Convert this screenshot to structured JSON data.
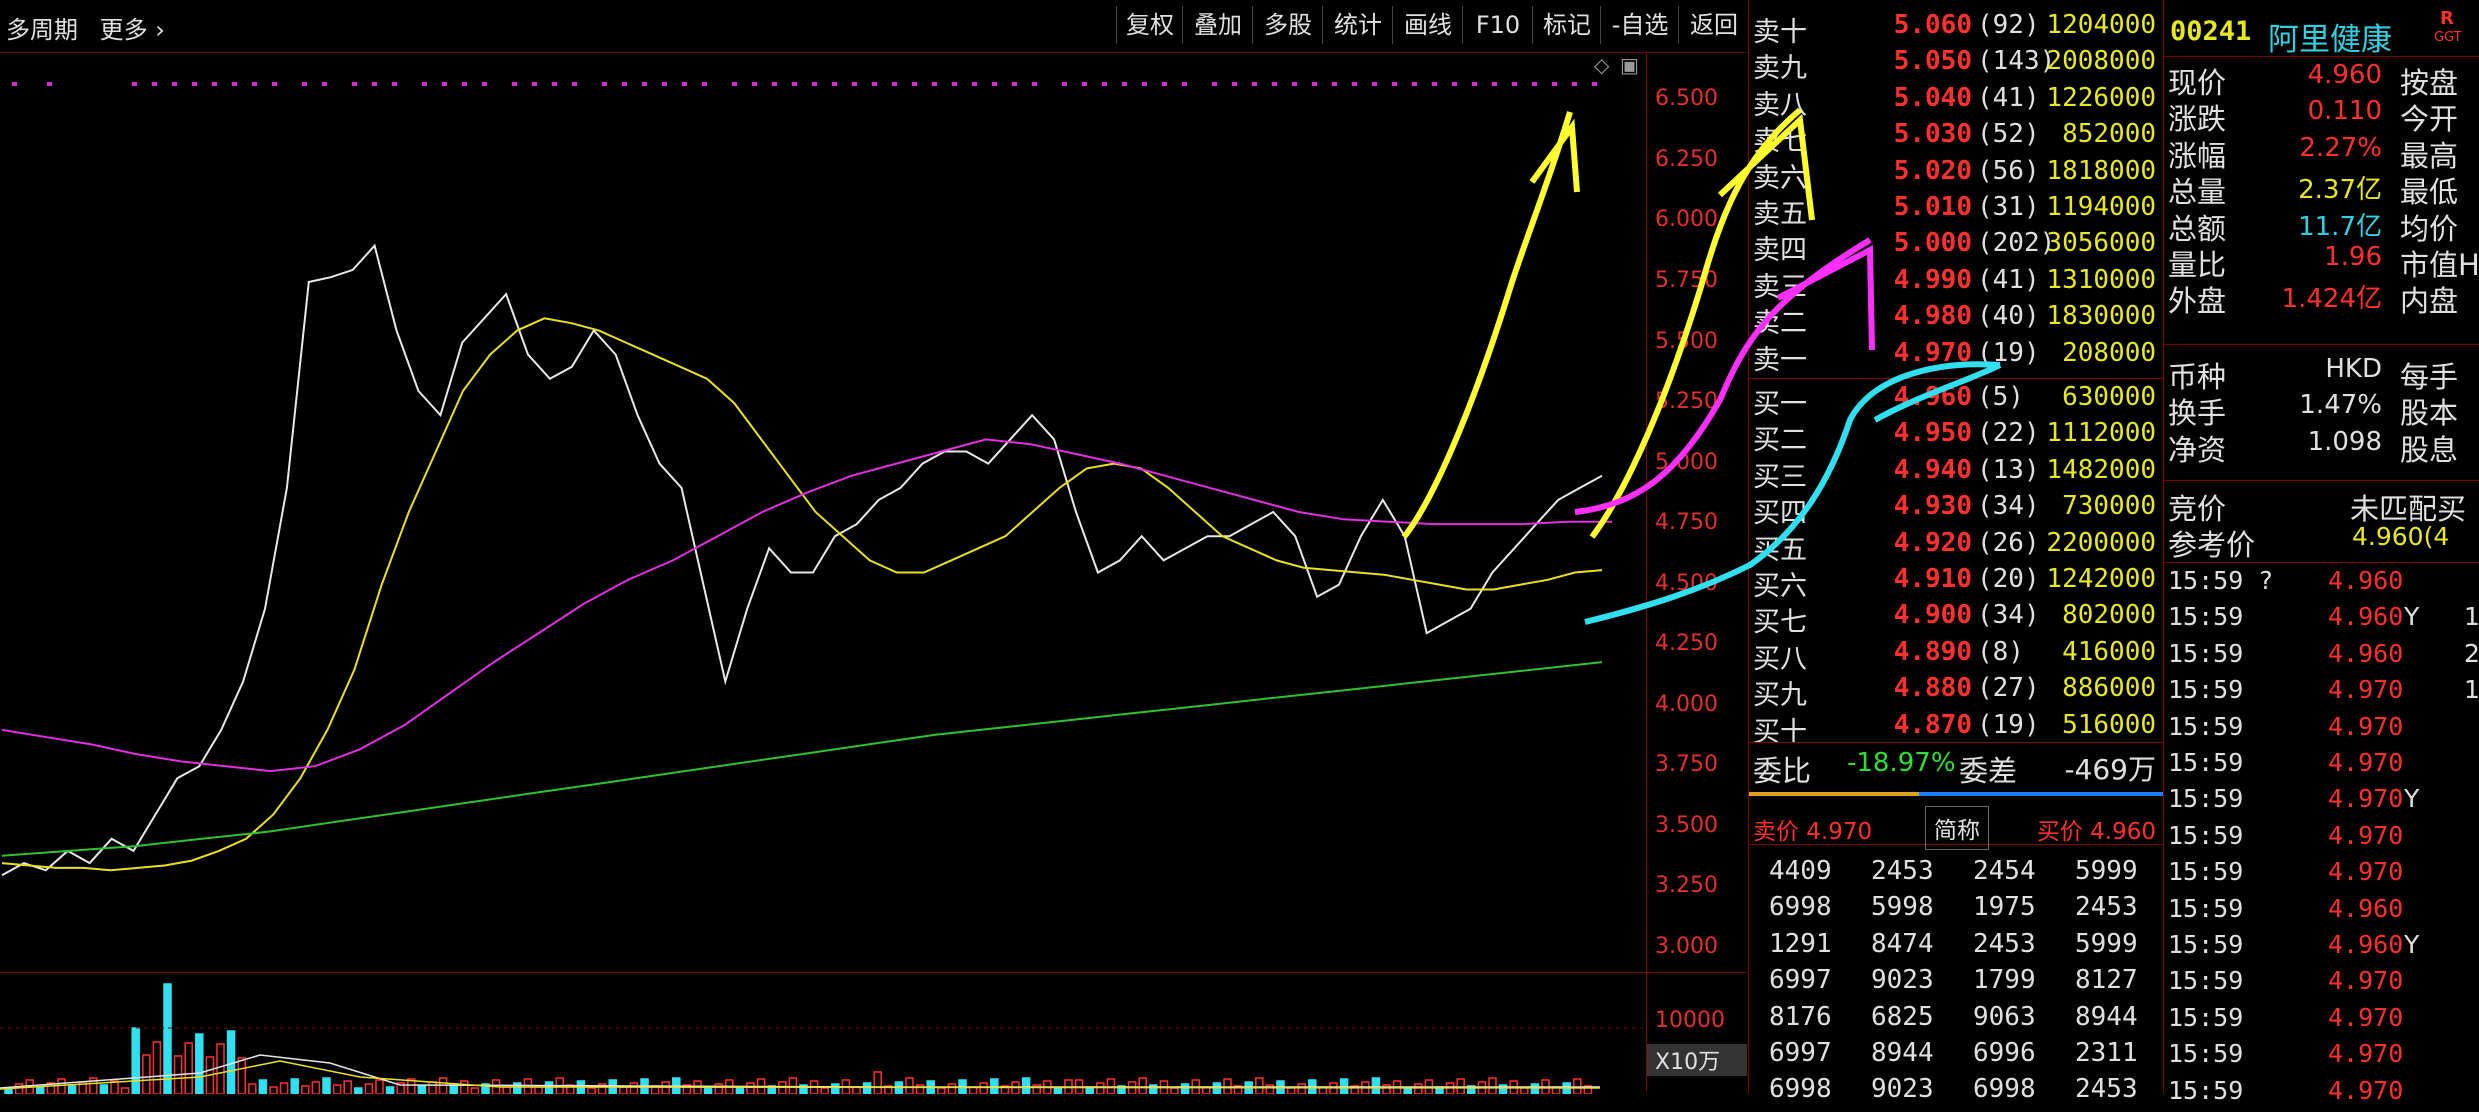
{
  "toolbar": {
    "period_label": "多周期",
    "more_label": "更多",
    "buttons": [
      "复权",
      "叠加",
      "多股",
      "统计",
      "画线",
      "F10",
      "标记",
      "-自选",
      "返回"
    ]
  },
  "price_axis": [
    "6.500",
    "6.250",
    "6.000",
    "5.750",
    "5.500",
    "5.250",
    "5.000",
    "4.750",
    "4.500",
    "4.250",
    "4.000",
    "3.750",
    "3.500",
    "3.250",
    "3.000"
  ],
  "volume_axis": {
    "top_label": "10000",
    "unit_label": "X10万"
  },
  "orderbook": {
    "asks": [
      {
        "label": "卖十",
        "price": "5.060",
        "count": "(92)",
        "volume": "1204000"
      },
      {
        "label": "卖九",
        "price": "5.050",
        "count": "(143)",
        "volume": "2008000"
      },
      {
        "label": "卖八",
        "price": "5.040",
        "count": "(41)",
        "volume": "1226000"
      },
      {
        "label": "卖七",
        "price": "5.030",
        "count": "(52)",
        "volume": "852000"
      },
      {
        "label": "卖六",
        "price": "5.020",
        "count": "(56)",
        "volume": "1818000"
      },
      {
        "label": "卖五",
        "price": "5.010",
        "count": "(31)",
        "volume": "1194000"
      },
      {
        "label": "卖四",
        "price": "5.000",
        "count": "(202)",
        "volume": "3056000"
      },
      {
        "label": "卖三",
        "price": "4.990",
        "count": "(41)",
        "volume": "1310000"
      },
      {
        "label": "卖二",
        "price": "4.980",
        "count": "(40)",
        "volume": "1830000"
      },
      {
        "label": "卖一",
        "price": "4.970",
        "count": "(19)",
        "volume": "208000"
      }
    ],
    "bids": [
      {
        "label": "买一",
        "price": "4.960",
        "count": "(5)",
        "volume": "630000"
      },
      {
        "label": "买二",
        "price": "4.950",
        "count": "(22)",
        "volume": "1112000"
      },
      {
        "label": "买三",
        "price": "4.940",
        "count": "(13)",
        "volume": "1482000"
      },
      {
        "label": "买四",
        "price": "4.930",
        "count": "(34)",
        "volume": "730000"
      },
      {
        "label": "买五",
        "price": "4.920",
        "count": "(26)",
        "volume": "2200000"
      },
      {
        "label": "买六",
        "price": "4.910",
        "count": "(20)",
        "volume": "1242000"
      },
      {
        "label": "买七",
        "price": "4.900",
        "count": "(34)",
        "volume": "802000"
      },
      {
        "label": "买八",
        "price": "4.890",
        "count": "(8)",
        "volume": "416000"
      },
      {
        "label": "买九",
        "price": "4.880",
        "count": "(27)",
        "volume": "886000"
      },
      {
        "label": "买十",
        "price": "4.870",
        "count": "(19)",
        "volume": "516000"
      }
    ],
    "ratio_label": "委比",
    "ratio_value": "-18.97%",
    "diff_label": "委差",
    "diff_value": "-469万",
    "ask_price_label": "卖价 4.970",
    "short_name_label": "简称",
    "bid_price_label": "买价 4.960",
    "broker_rows": [
      [
        "4409",
        "2453",
        "2454",
        "5999"
      ],
      [
        "6998",
        "5998",
        "1975",
        "2453"
      ],
      [
        "1291",
        "8474",
        "2453",
        "5999"
      ],
      [
        "6997",
        "9023",
        "1799",
        "8127"
      ],
      [
        "8176",
        "6825",
        "9063",
        "8944"
      ],
      [
        "6997",
        "8944",
        "6996",
        "2311"
      ],
      [
        "6998",
        "9023",
        "6998",
        "2453"
      ]
    ]
  },
  "stock": {
    "code": "00241",
    "name": "阿里健康",
    "badge_r": "R",
    "badge_ggt": "GGT",
    "fields": [
      {
        "label": "现价",
        "value": "4.960",
        "right": "按盘"
      },
      {
        "label": "涨跌",
        "value": "0.110",
        "right": "今开"
      },
      {
        "label": "涨幅",
        "value": "2.27%",
        "right": "最高"
      },
      {
        "label": "总量",
        "value": "2.37亿",
        "right": "最低"
      },
      {
        "label": "总额",
        "value": "11.7亿",
        "right": "均价"
      },
      {
        "label": "量比",
        "value": "1.96",
        "right": "市值H"
      },
      {
        "label": "外盘",
        "value": "1.424亿",
        "right": "内盘"
      }
    ],
    "fields2": [
      {
        "label": "币种",
        "value": "HKD",
        "right": "每手"
      },
      {
        "label": "换手",
        "value": "1.47%",
        "right": "股本"
      },
      {
        "label": "净资",
        "value": "1.098",
        "right": "股息"
      }
    ],
    "auction_label": "竞价",
    "auction_value": "未匹配买",
    "ref_label": "参考价",
    "ref_value": "4.960(4"
  },
  "ticks": [
    {
      "time": "15:59 ?",
      "price": "4.960",
      "flag": "",
      "extra": ""
    },
    {
      "time": "15:59",
      "price": "4.960",
      "flag": "Y",
      "extra": "1"
    },
    {
      "time": "15:59",
      "price": "4.960",
      "flag": "",
      "extra": "2"
    },
    {
      "time": "15:59",
      "price": "4.970",
      "flag": "",
      "extra": "1"
    },
    {
      "time": "15:59",
      "price": "4.970",
      "flag": "",
      "extra": ""
    },
    {
      "time": "15:59",
      "price": "4.970",
      "flag": "",
      "extra": ""
    },
    {
      "time": "15:59",
      "price": "4.970",
      "flag": "Y",
      "extra": ""
    },
    {
      "time": "15:59",
      "price": "4.970",
      "flag": "",
      "extra": ""
    },
    {
      "time": "15:59",
      "price": "4.970",
      "flag": "",
      "extra": ""
    },
    {
      "time": "15:59",
      "price": "4.960",
      "flag": "",
      "extra": ""
    },
    {
      "time": "15:59",
      "price": "4.960",
      "flag": "Y",
      "extra": ""
    },
    {
      "time": "15:59",
      "price": "4.970",
      "flag": "",
      "extra": ""
    },
    {
      "time": "15:59",
      "price": "4.970",
      "flag": "",
      "extra": ""
    },
    {
      "time": "15:59",
      "price": "4.970",
      "flag": "",
      "extra": ""
    },
    {
      "time": "15:59",
      "price": "4.970",
      "flag": "",
      "extra": ""
    }
  ],
  "colors": {
    "up": "#ff3030",
    "down": "#30d0e0",
    "accent": "#e8e820",
    "grid": "#7a0000"
  },
  "chart_data": {
    "type": "line",
    "ylim": [
      2.9,
      6.7
    ],
    "series": [
      {
        "values": [
          3.3,
          3.35,
          3.32,
          3.4,
          3.35,
          3.45,
          3.4,
          3.55,
          3.7,
          3.75,
          3.9,
          4.1,
          4.4,
          4.9,
          5.75,
          5.77,
          5.8,
          5.9,
          5.55,
          5.3,
          5.2,
          5.5,
          5.6,
          5.7,
          5.45,
          5.35,
          5.4,
          5.55,
          5.45,
          5.2,
          5.0,
          4.9,
          4.5,
          4.1,
          4.4,
          4.65,
          4.55,
          4.55,
          4.7,
          4.75,
          4.85,
          4.9,
          5.0,
          5.05,
          5.05,
          5.0,
          5.1,
          5.2,
          5.1,
          4.8,
          4.55,
          4.6,
          4.7,
          4.6,
          4.65,
          4.7,
          4.7,
          4.75,
          4.8,
          4.7,
          4.45,
          4.5,
          4.7,
          4.85,
          4.7,
          4.3,
          4.35,
          4.4,
          4.55,
          4.65,
          4.75,
          4.85,
          4.9,
          4.95
        ]
      },
      {
        "values": [
          3.35,
          3.34,
          3.33,
          3.33,
          3.32,
          3.33,
          3.34,
          3.36,
          3.4,
          3.45,
          3.55,
          3.7,
          3.9,
          4.15,
          4.5,
          4.8,
          5.05,
          5.3,
          5.45,
          5.55,
          5.6,
          5.58,
          5.55,
          5.5,
          5.45,
          5.4,
          5.35,
          5.25,
          5.1,
          4.95,
          4.8,
          4.7,
          4.6,
          4.55,
          4.55,
          4.6,
          4.65,
          4.7,
          4.8,
          4.9,
          4.98,
          5.0,
          4.98,
          4.9,
          4.8,
          4.7,
          4.65,
          4.6,
          4.57,
          4.56,
          4.55,
          4.54,
          4.52,
          4.5,
          4.48,
          4.48,
          4.5,
          4.52,
          4.55,
          4.56
        ]
      },
      {
        "values": [
          3.9,
          3.87,
          3.84,
          3.8,
          3.77,
          3.75,
          3.73,
          3.75,
          3.82,
          3.92,
          4.05,
          4.18,
          4.3,
          4.42,
          4.52,
          4.6,
          4.7,
          4.8,
          4.88,
          4.95,
          5.0,
          5.05,
          5.1,
          5.08,
          5.04,
          5.0,
          4.95,
          4.9,
          4.85,
          4.8,
          4.77,
          4.76,
          4.75,
          4.75,
          4.75,
          4.76,
          4.76
        ]
      },
      {
        "values": [
          3.38,
          3.4,
          3.42,
          3.45,
          3.48,
          3.52,
          3.56,
          3.6,
          3.64,
          3.68,
          3.72,
          3.76,
          3.8,
          3.84,
          3.88,
          3.91,
          3.94,
          3.97,
          4.0,
          4.03,
          4.06,
          4.09,
          4.12,
          4.15,
          4.18
        ]
      }
    ]
  }
}
